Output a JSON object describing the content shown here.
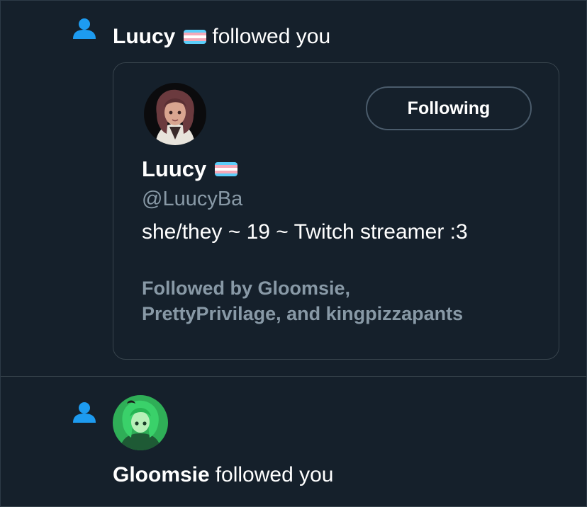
{
  "notifications": [
    {
      "type": "follow",
      "icon": "person-icon",
      "display_name": "Luucy",
      "name_emoji": "transgender-flag",
      "action_text": "followed you",
      "card": {
        "display_name": "Luucy",
        "handle": "@LuucyBa",
        "bio": "she/they ~ 19 ~ Twitch streamer :3",
        "follow_button_label": "Following",
        "followed_by_line1": "Followed by Gloomsie,",
        "followed_by_line2": "PrettyPrivilage, and kingpizzapants"
      }
    },
    {
      "type": "follow",
      "icon": "person-icon",
      "display_name": "Gloomsie",
      "action_text": "followed you"
    }
  ],
  "colors": {
    "background": "#15202b",
    "accent": "#1d9bf0",
    "secondary_text": "#8899a6",
    "border": "#38444d",
    "flag_blue": "#5bcefa",
    "flag_pink": "#f5a9b8",
    "flag_white": "#ffffff"
  }
}
